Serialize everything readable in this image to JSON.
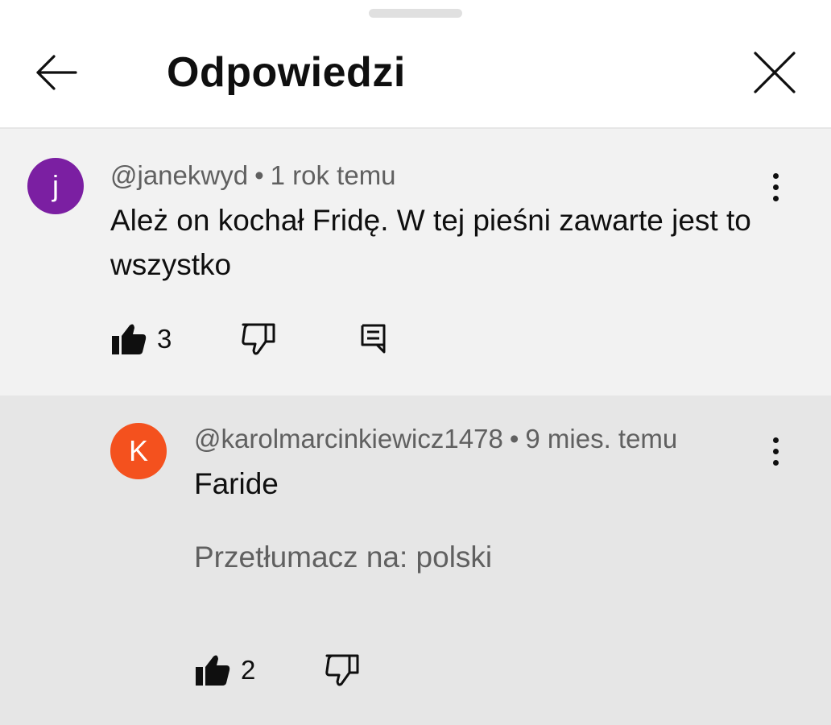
{
  "header": {
    "title": "Odpowiedzi",
    "back_icon": "arrow-left-icon",
    "close_icon": "close-icon"
  },
  "comments": [
    {
      "avatar_letter": "j",
      "avatar_color": "#7b1fa2",
      "author": "@janekwyd",
      "separator": "•",
      "time": "1 rok temu",
      "text": "Ależ on kochał Fridę. W tej pieśni zawarte jest to wszystko",
      "likes": "3",
      "icons": [
        "thumb-up-icon",
        "thumb-down-icon",
        "reply-icon",
        "more-vert-icon"
      ]
    },
    {
      "avatar_letter": "K",
      "avatar_color": "#f4511e",
      "author": "@karolmarcinkiewicz1478",
      "separator": "•",
      "time": "9 mies. temu",
      "text": "Faride",
      "translate": "Przetłumacz na: polski",
      "likes": "2",
      "icons": [
        "thumb-up-icon",
        "thumb-down-icon",
        "more-vert-icon"
      ]
    }
  ]
}
